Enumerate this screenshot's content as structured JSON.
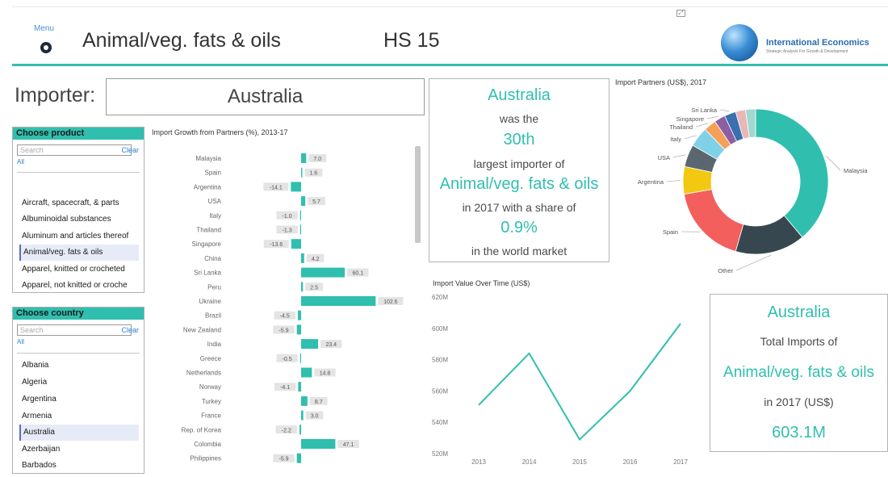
{
  "header": {
    "menu_label": "Menu",
    "title": "Animal/veg. fats & oils",
    "hs_code": "HS 15",
    "logo_name": "International Economics",
    "logo_tagline": "Strategic Analysis For Growth & Development"
  },
  "importer": {
    "label": "Importer:",
    "value": "Australia"
  },
  "product_slicer": {
    "title": "Choose product",
    "search_placeholder": "Search",
    "clear": "Clear",
    "all": "All",
    "items": [
      "Aircraft, spacecraft, & parts",
      "Albuminoidal substances",
      "Aluminum and articles thereof",
      "Animal/veg. fats & oils",
      "Apparel, knitted or crocheted",
      "Apparel, not knitted or croche"
    ],
    "selected_index": 3
  },
  "country_slicer": {
    "title": "Choose country",
    "search_placeholder": "Search",
    "clear": "Clear",
    "all": "All",
    "items": [
      "Albania",
      "Algeria",
      "Argentina",
      "Armenia",
      "Australia",
      "Azerbaijan",
      "Barbados"
    ],
    "selected_index": 4
  },
  "rank_card": {
    "country": "Australia",
    "text1": "was the",
    "rank": "30th",
    "text2": "largest importer of",
    "product": "Animal/veg. fats & oils",
    "text3": "in 2017 with a share of",
    "share": "0.9%",
    "text4": "in the world market"
  },
  "total_card": {
    "country": "Australia",
    "text1": "Total Imports of",
    "product": "Animal/veg. fats & oils",
    "text2": "in 2017 (US$)",
    "value": "603.1M"
  },
  "colors": {
    "accent": "#30bfae",
    "negative": "#30bfae",
    "label_bg": "#e4e4e4"
  },
  "chart_data": [
    {
      "type": "bar",
      "title": "Import Growth from Partners (%), 2013-17",
      "orientation": "horizontal",
      "categories": [
        "Malaysia",
        "Spain",
        "Argentina",
        "USA",
        "Italy",
        "Thailand",
        "Singapore",
        "China",
        "Sri Lanka",
        "Peru",
        "Ukraine",
        "Brazil",
        "New Zealand",
        "India",
        "Greece",
        "Netherlands",
        "Norway",
        "Turkey",
        "France",
        "Rep. of Korea",
        "Colombia",
        "Philippines"
      ],
      "values": [
        7.0,
        1.6,
        -14.1,
        5.7,
        -1.0,
        -1.3,
        -13.6,
        4.2,
        60.1,
        2.5,
        102.6,
        -4.5,
        -5.9,
        23.4,
        -0.5,
        14.8,
        -4.1,
        8.7,
        3.0,
        -2.2,
        47.1,
        -5.9
      ],
      "labels": [
        "7.0",
        "1.6",
        "-14.1",
        "5.7",
        "-1.0",
        "-1.3",
        "-13.6",
        "4.2",
        "60.1",
        "2.5",
        "102.6",
        "-4.5",
        "-5.9",
        "23.4",
        "-0.5",
        "14.8",
        "-4.1",
        "8.7",
        "3.0",
        "-2.2",
        "47.1",
        "-5.9"
      ]
    },
    {
      "type": "pie",
      "title": "Import Partners (US$), 2017",
      "donut": true,
      "categories": [
        "Malaysia",
        "Other",
        "Spain",
        "Argentina",
        "USA",
        "Italy",
        "Thailand",
        "Singapore",
        "Sri Lanka",
        "small-1",
        "small-2"
      ],
      "labels_shown": [
        "Malaysia",
        "Other",
        "Spain",
        "Argentina",
        "USA",
        "Italy",
        "Thailand",
        "Singapore",
        "Sri Lanka"
      ],
      "values": [
        35,
        14,
        16,
        5.5,
        4.5,
        4,
        2.5,
        2.2,
        2.3,
        2,
        2
      ],
      "colors": [
        "#30bfae",
        "#37474f",
        "#f25f5c",
        "#f2c811",
        "#5a6770",
        "#7fd1e8",
        "#f5a05a",
        "#8e5ea2",
        "#3a6fb0",
        "#e8b7b7",
        "#9fd9cf"
      ]
    },
    {
      "type": "line",
      "title": "Import Value Over Time (US$)",
      "x": [
        "2013",
        "2014",
        "2015",
        "2016",
        "2017"
      ],
      "values": [
        551,
        584,
        529,
        560,
        603
      ],
      "ylim": [
        520,
        620
      ],
      "yticks": [
        "620M",
        "600M",
        "580M",
        "560M",
        "540M",
        "520M"
      ]
    }
  ]
}
